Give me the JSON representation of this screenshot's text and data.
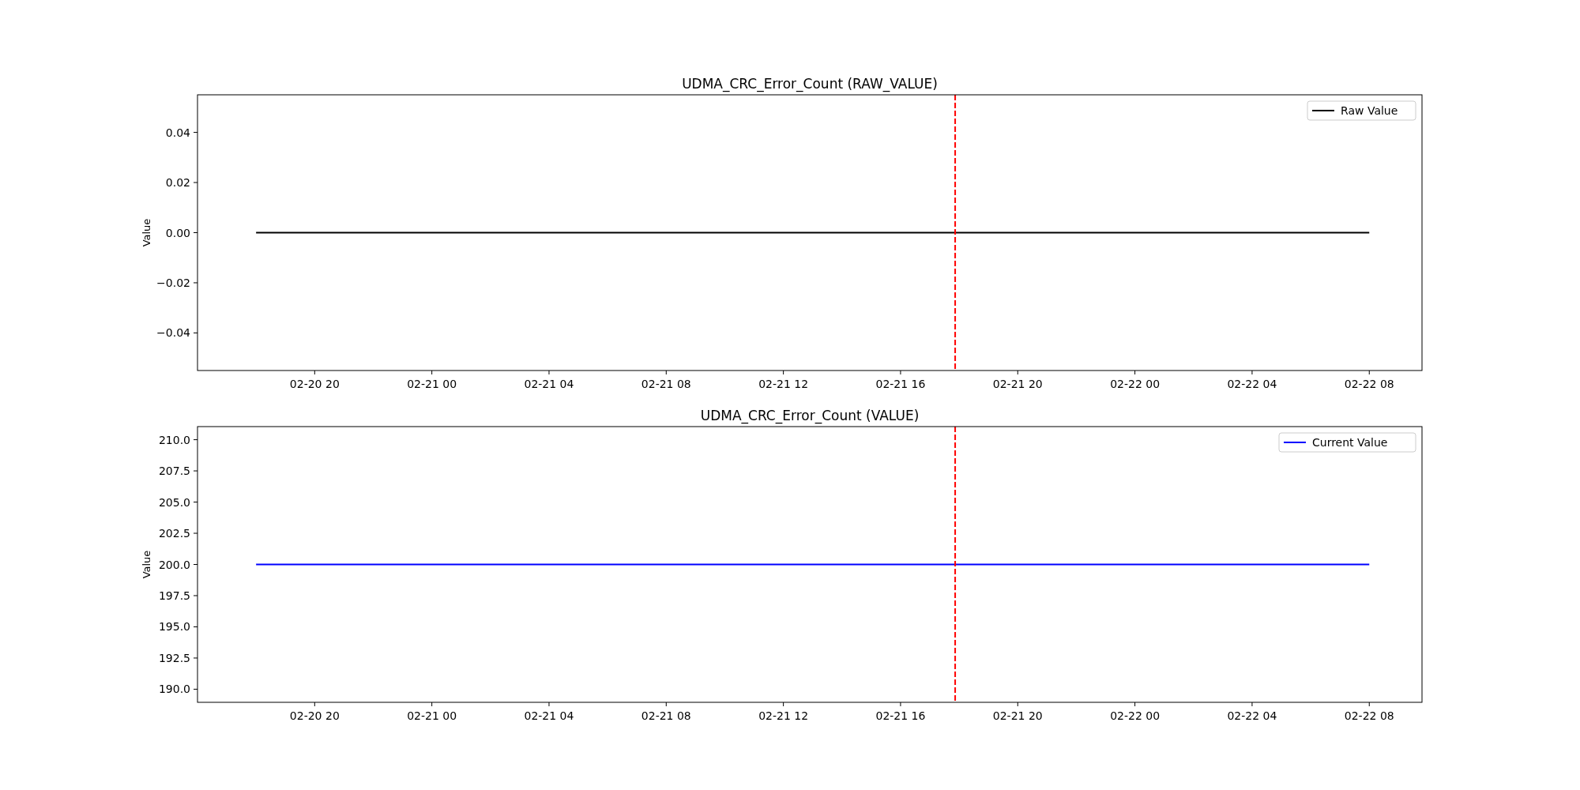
{
  "charts": [
    {
      "chart_data": {
        "type": "line",
        "title": "UDMA_CRC_Error_Count (RAW_VALUE)",
        "ylabel": "Value",
        "categories": [
          null,
          "02-20 20",
          null,
          "02-21 00",
          null,
          "02-21 04",
          null,
          "02-21 08",
          null,
          "02-21 12",
          null,
          "02-21 16",
          null,
          "02-21 20",
          null,
          "02-22 00",
          null,
          "02-22 04",
          null,
          "02-22 08"
        ],
        "series": [
          {
            "name": "Raw Value",
            "color": "#000000",
            "values": [
              0,
              0,
              0,
              0,
              0,
              0,
              0,
              0,
              0,
              0,
              0,
              0,
              0,
              0,
              0,
              0,
              0,
              0,
              0,
              0
            ]
          }
        ],
        "ylim": [
          -0.055,
          0.055
        ],
        "yticks": [
          {
            "value": -0.04,
            "label": "−0.04"
          },
          {
            "value": -0.02,
            "label": "−0.02"
          },
          {
            "value": 0,
            "label": "0.00"
          },
          {
            "value": 0.02,
            "label": "0.02"
          },
          {
            "value": 0.04,
            "label": "0.04"
          }
        ]
      }
    },
    {
      "chart_data": {
        "type": "line",
        "title": "UDMA_CRC_Error_Count (VALUE)",
        "ylabel": "Value",
        "categories": [
          null,
          "02-20 20",
          null,
          "02-21 00",
          null,
          "02-21 04",
          null,
          "02-21 08",
          null,
          "02-21 12",
          null,
          "02-21 16",
          null,
          "02-21 20",
          null,
          "02-22 00",
          null,
          "02-22 04",
          null,
          "02-22 08"
        ],
        "series": [
          {
            "name": "Current Value",
            "color": "#0000ff",
            "values": [
              200,
              200,
              200,
              200,
              200,
              200,
              200,
              200,
              200,
              200,
              200,
              200,
              200,
              200,
              200,
              200,
              200,
              200,
              200,
              200
            ]
          }
        ],
        "ylim": [
          188.95,
          211.05
        ],
        "yticks": [
          {
            "value": 190,
            "label": "190.0"
          },
          {
            "value": 192.5,
            "label": "192.5"
          },
          {
            "value": 195,
            "label": "195.0"
          },
          {
            "value": 197.5,
            "label": "197.5"
          },
          {
            "value": 200,
            "label": "200.0"
          },
          {
            "value": 202.5,
            "label": "202.5"
          },
          {
            "value": 205,
            "label": "205.0"
          },
          {
            "value": 207.5,
            "label": "207.5"
          },
          {
            "value": 210,
            "label": "210.0"
          }
        ]
      }
    }
  ]
}
